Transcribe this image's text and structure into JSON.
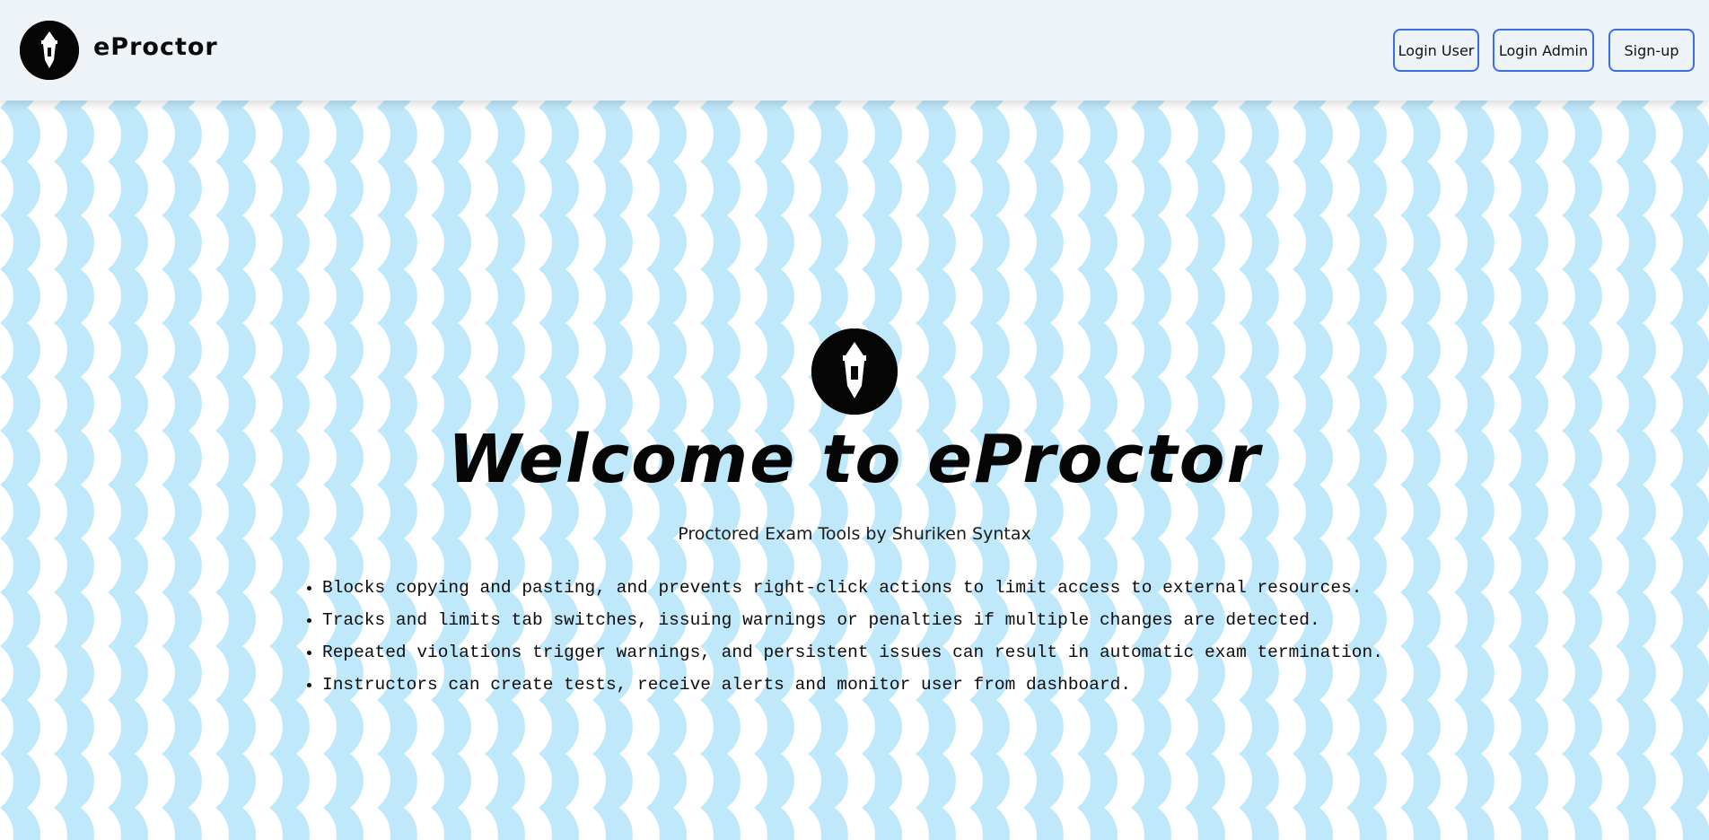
{
  "app": {
    "brand_name": "eProctor",
    "logo_icon": "lantern-logo-icon"
  },
  "nav": {
    "login_user_label": "Login User",
    "login_admin_label": "Login Admin",
    "signup_label": "Sign-up",
    "button_border_color": "#3b6fe0"
  },
  "hero": {
    "title": "Welcome to eProctor",
    "subtitle": "Proctored Exam Tools by Shuriken Syntax",
    "features": [
      "Blocks copying and pasting, and prevents right-click actions to limit access to external resources.",
      "Tracks and limits tab switches, issuing warnings or penalties if multiple changes are detected.",
      "Repeated violations trigger warnings, and persistent issues can result in automatic exam termination.",
      "Instructors can create tests, receive alerts and monitor user from dashboard."
    ]
  },
  "colors": {
    "header_bg": "#eef3f8",
    "pattern_blue": "#bfe9fb",
    "pattern_white": "#ffffff",
    "text": "#0a0a0a"
  }
}
